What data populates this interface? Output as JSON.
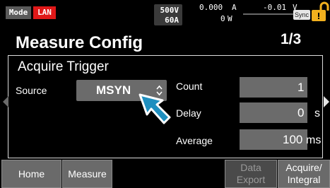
{
  "status": {
    "mode_label": "Mode",
    "lan_label": "LAN",
    "voltage_set": "500V",
    "current_set": "60A",
    "current_reading": "0.000",
    "current_reading_unit": "A",
    "power_reading": "0",
    "power_unit": "W",
    "voltage_reading": "-0.01",
    "voltage_reading_unit": "V",
    "sync_label": "Sync",
    "colors": {
      "lan": "#e01818",
      "warn": "#f2b01e",
      "pointer": "#1f8fbf"
    }
  },
  "header": {
    "title": "Measure Config",
    "page": "1/3"
  },
  "panel": {
    "title": "Acquire Trigger",
    "source_label": "Source",
    "source_value": "MSYN",
    "count_label": "Count",
    "count_value": "1",
    "delay_label": "Delay",
    "delay_value": "0",
    "delay_unit": "s",
    "average_label": "Average",
    "average_value": "100",
    "average_unit": "ms"
  },
  "softkeys": {
    "home": "Home",
    "measure": "Measure",
    "data_export_line1": "Data",
    "data_export_line2": "Export",
    "acquire_line1": "Acquire/",
    "acquire_line2": "Integral"
  }
}
